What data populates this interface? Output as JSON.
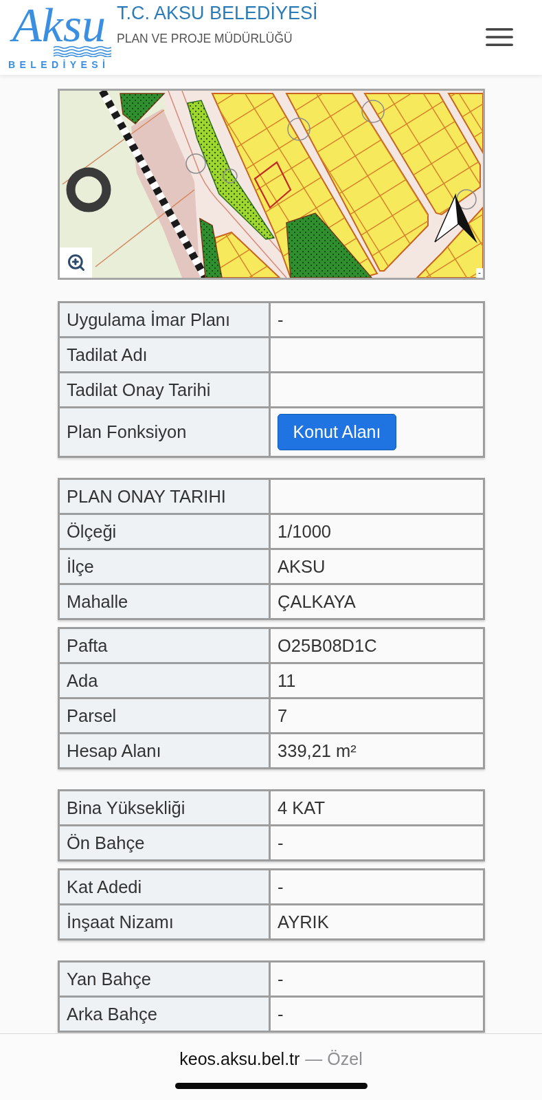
{
  "header": {
    "logo": {
      "wordmark": "Aksu",
      "tagline": "BELEDİYESİ"
    },
    "title": "T.C. AKSU BELEDİYESİ",
    "subtitle": "PLAN VE PROJE MÜDÜRLÜĞÜ"
  },
  "map": {
    "attribution": "-"
  },
  "sections": [
    {
      "tables": [
        {
          "rows": [
            {
              "kind": "text",
              "label": "Uygulama İmar Planı",
              "value": "-"
            },
            {
              "kind": "text",
              "label": "Tadilat Adı"
            },
            {
              "kind": "text",
              "label": "Tadilat Onay Tarihi"
            },
            {
              "kind": "button",
              "label": "Plan Fonksiyon",
              "value": "Konut Alanı"
            }
          ]
        }
      ]
    },
    {
      "tables": [
        {
          "rows": [
            {
              "kind": "text",
              "label": "PLAN ONAY TARIHI"
            },
            {
              "kind": "text",
              "label": "Ölçeği",
              "value": "1/1000"
            },
            {
              "kind": "text",
              "label": "İlçe",
              "value": "AKSU"
            },
            {
              "kind": "text",
              "label": "Mahalle",
              "value": "ÇALKAYA"
            }
          ]
        },
        {
          "rows": [
            {
              "kind": "text",
              "label": "Pafta",
              "value": "O25B08D1C"
            },
            {
              "kind": "text",
              "label": "Ada",
              "value": "11"
            },
            {
              "kind": "text",
              "label": "Parsel",
              "value": "7"
            },
            {
              "kind": "text",
              "label": "Hesap Alanı",
              "value": "339,21 m²"
            }
          ]
        }
      ]
    },
    {
      "tables": [
        {
          "rows": [
            {
              "kind": "text",
              "label": "Bina Yüksekliği",
              "value": "4 KAT"
            },
            {
              "kind": "text",
              "label": "Ön Bahçe",
              "value": "-"
            }
          ]
        },
        {
          "rows": [
            {
              "kind": "text",
              "label": "Kat Adedi",
              "value": "-"
            },
            {
              "kind": "text",
              "label": "İnşaat Nizamı",
              "value": "AYRIK"
            }
          ]
        }
      ]
    },
    {
      "tables": [
        {
          "rows": [
            {
              "kind": "text",
              "label": "Yan Bahçe",
              "value": "-"
            },
            {
              "kind": "text",
              "label": "Arka Bahçe",
              "value": "-"
            }
          ]
        }
      ]
    }
  ],
  "browser_bar": {
    "address": "keos.aksu.bel.tr",
    "mode": "— Özel"
  }
}
